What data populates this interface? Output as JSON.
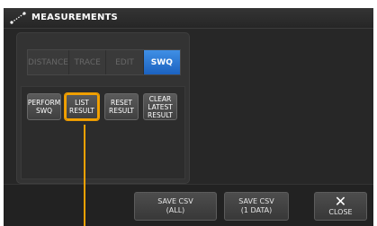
{
  "window": {
    "title": "MEASUREMENTS",
    "title_icon": "measure-ruler-icon"
  },
  "tabs": [
    {
      "label": "DISTANCE",
      "active": false
    },
    {
      "label": "TRACE",
      "active": false
    },
    {
      "label": "EDIT",
      "active": false
    },
    {
      "label": "SWQ",
      "active": true
    }
  ],
  "actions": [
    {
      "label": "PERFORM\nSWQ",
      "highlighted": false
    },
    {
      "label": "LIST\nRESULT",
      "highlighted": true
    },
    {
      "label": "RESET\nRESULT",
      "highlighted": false
    },
    {
      "label": "CLEAR\nLATEST\nRESULT",
      "highlighted": false
    }
  ],
  "bottom": {
    "save_csv_all": "SAVE CSV\n(ALL)",
    "save_csv_one": "SAVE CSV\n(1 DATA)",
    "close_icon": "close-x-icon",
    "close_label": "CLOSE"
  },
  "colors": {
    "accent_blue": "#2a7ad6",
    "highlight_orange": "#f2a100"
  }
}
